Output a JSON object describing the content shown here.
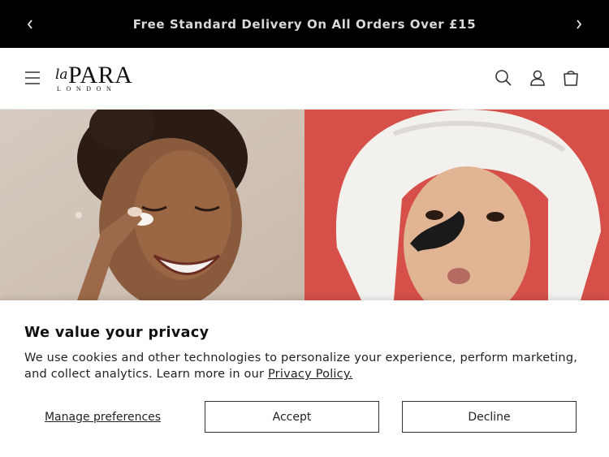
{
  "announcement": {
    "text": "Free Standard Delivery On All Orders Over £15",
    "prev_icon": "chevron-left-icon",
    "next_icon": "chevron-right-icon"
  },
  "header": {
    "logo": {
      "script": "la",
      "main": "PARA",
      "sub": "LONDON"
    },
    "icons": [
      "menu-icon",
      "search-icon",
      "account-icon",
      "cart-icon"
    ]
  },
  "hero": {
    "left_image": "woman applying face cream",
    "right_image": "woman in towel with nose strip"
  },
  "cookie_banner": {
    "title": "We value your privacy",
    "body": "We use cookies and other technologies to personalize your experience, perform marketing, and collect analytics. Learn more in our",
    "link": "Privacy Policy.",
    "manage_label": "Manage preferences",
    "accept_label": "Accept",
    "decline_label": "Decline"
  }
}
